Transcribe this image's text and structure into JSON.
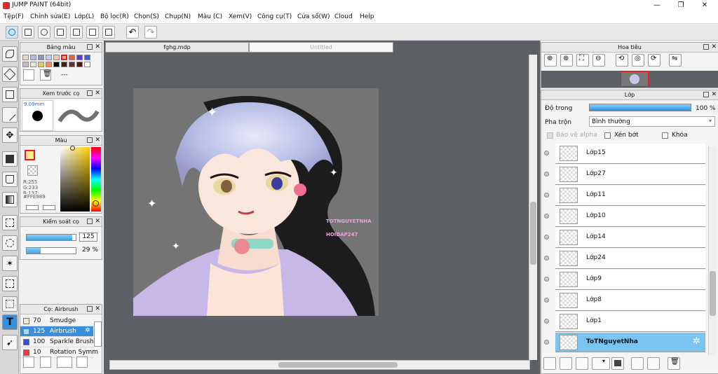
{
  "app": {
    "title": "JUMP PAINT (64bit)",
    "minimize": "—",
    "maximize": "❐",
    "close": "✕"
  },
  "menu": [
    "Tệp(F)",
    "Chỉnh sửa(E)",
    "Lớp(L)",
    "Bộ lọc(R)",
    "Chọn(S)",
    "Chụp(N)",
    "Màu (C)",
    "Xem(V)",
    "Công cụ(T)",
    "Cửa sổ(W)",
    "Cloud",
    "Help"
  ],
  "tabs": {
    "active": "fghg.mdp",
    "inactive": "Untitled"
  },
  "palette": {
    "title": "Bảng màu",
    "label": "---",
    "colors": [
      "#e8d8c8",
      "#b8b8d8",
      "#9090c0",
      "#c8c8e8",
      "#f0c8b0",
      "#f8a080",
      "#e86040",
      "#6040c0",
      "#4060e0",
      "#c0c0c0",
      "#e8e8e0",
      "#e8c850",
      "#f09060",
      "#000000",
      "#402020",
      "#603030",
      "#501818",
      "#ffffff"
    ]
  },
  "preview": {
    "title": "Xem trước cọ",
    "size": "9.09mm"
  },
  "color": {
    "title": "Màu",
    "r": "R:255",
    "g": "G:233",
    "b": "B:137",
    "hex": "#FFE989",
    "fg": "#FFE989"
  },
  "brush_control": {
    "title": "Kiểm soát cọ",
    "size": "125",
    "opacity": "29 %",
    "size_fill": 0.93,
    "opacity_fill": 0.29
  },
  "brush_list": {
    "title": "Cọ: Airbrush",
    "items": [
      {
        "num": "70",
        "name": "Smudge",
        "color": "#f8e8d0"
      },
      {
        "num": "125",
        "name": "Airbrush",
        "color": "#a8d8f0"
      },
      {
        "num": "100",
        "name": "Sparkle Brush",
        "color": "#3050e0"
      },
      {
        "num": "10",
        "name": "Rotation Symm",
        "color": "#e04040"
      }
    ]
  },
  "navigator": {
    "title": "Hoa tiêu"
  },
  "layers": {
    "title": "Lớp",
    "opacity_label": "Độ trong",
    "opacity_value": "100 %",
    "blend_label": "Pha trộn",
    "blend_value": "Bình thường",
    "protect_alpha": "Bảo vệ alpha",
    "clip": "Xén bớt",
    "lock": "Khóa",
    "items": [
      "Lớp15",
      "Lớp27",
      "Lớp11",
      "Lớp10",
      "Lớp14",
      "Lớp24",
      "Lớp9",
      "Lớp8",
      "Lớp1",
      "ToTNguyetNha"
    ]
  },
  "artwork": {
    "watermark1": "TOTNGUYETNHA",
    "watermark2": "HOIDAP247"
  }
}
